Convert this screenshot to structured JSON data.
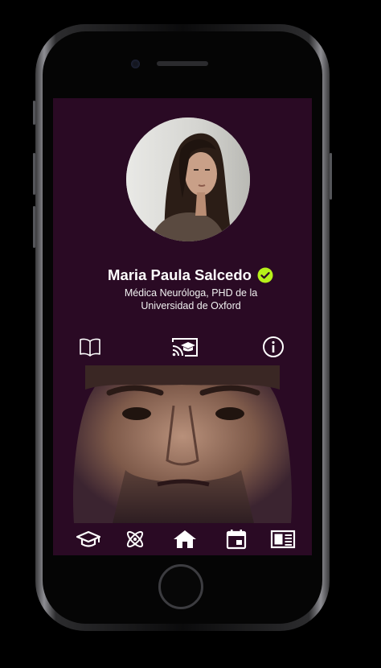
{
  "profile": {
    "name": "Maria Paula Salcedo",
    "subtitle_line1": "Médica Neuróloga, PHD de la",
    "subtitle_line2": "Universidad de Oxford",
    "verified": true
  },
  "tabs": [
    {
      "id": "book",
      "icon": "book-icon"
    },
    {
      "id": "cast",
      "icon": "cast-education-icon"
    },
    {
      "id": "info",
      "icon": "info-icon"
    }
  ],
  "bottom_nav": [
    {
      "id": "courses",
      "icon": "graduation-cap-icon"
    },
    {
      "id": "science",
      "icon": "atom-icon"
    },
    {
      "id": "home",
      "icon": "home-icon",
      "active": true
    },
    {
      "id": "calendar",
      "icon": "calendar-icon"
    },
    {
      "id": "news",
      "icon": "newspaper-icon"
    }
  ],
  "colors": {
    "background": "#2a0a24",
    "verified_badge": "#b6f01a",
    "text": "#ffffff"
  }
}
